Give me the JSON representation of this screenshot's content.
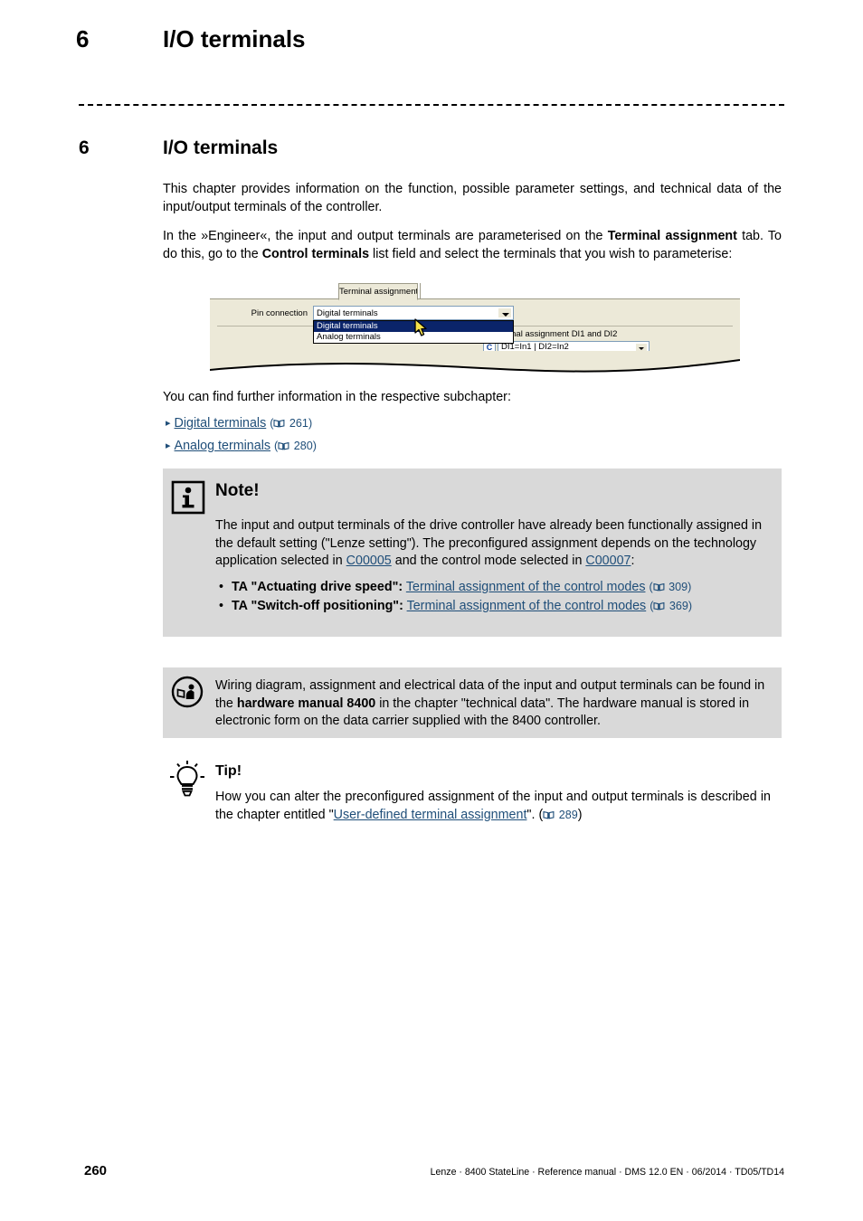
{
  "header": {
    "chapter_number": "6",
    "chapter_title": "I/O terminals"
  },
  "heading": {
    "number": "6",
    "title": "I/O terminals"
  },
  "intro": {
    "paragraph_1": "This chapter provides information on the function, possible parameter settings, and technical data of the input/output terminals of the controller.",
    "p2_part1": "In the »Engineer«, the input and output terminals are parameterised on the ",
    "p2_bold1": "Terminal assignment",
    "p2_part2": " tab. To do this, go to the ",
    "p2_bold2": "Control terminals",
    "p2_part3": " list field and select the terminals that you wish to parameterise:",
    "subchapter_lead": "You can find further information in the respective subchapter:"
  },
  "figure": {
    "tab_label": "Terminal assignment",
    "pin_connection_label": "Pin connection",
    "pin_connection_value": "Digital terminals",
    "dropdown_options": [
      {
        "label": "Digital terminals",
        "selected": true
      },
      {
        "label": "Analog terminals",
        "selected": false
      }
    ],
    "functional_assignment_label": "Functional assignment DI1 and DI2",
    "code_button_label": "C",
    "functional_assignment_value": "DI1=In1 | DI2=In2"
  },
  "subchapter_links": [
    {
      "text": "Digital terminals",
      "page": "261",
      "book_icon": "book-icon"
    },
    {
      "text": "Analog terminals",
      "page": "280",
      "book_icon": "book-icon"
    }
  ],
  "note_box": {
    "icon": "info-icon",
    "title": "Note!",
    "body": "The input and output terminals of the drive controller have already been functionally assigned in the default setting (\"Lenze setting\"). The preconfigured assignment depends on the technology application selected in",
    "link_c00005": "C00005",
    "body_mid": "and the control mode selected in",
    "link_c00007": "C00007",
    "body_end": ":",
    "bullets": [
      {
        "bold": "TA \"Actuating drive speed\":",
        "link": "Terminal assignment of the control modes",
        "page": "309"
      },
      {
        "bold": "TA \"Switch-off positioning\":",
        "link": "Terminal assignment of the control modes",
        "page": "369"
      }
    ]
  },
  "hardware_box": {
    "icon": "read-manual-icon",
    "text_part1": "Wiring diagram, assignment and electrical data of the input and output terminals can be found in the ",
    "bold": "hardware manual 8400",
    "text_part2": " in the chapter \"technical data\". The hardware manual is stored in electronic form on the data carrier supplied with the 8400 controller."
  },
  "tip_block": {
    "icon": "lightbulb-icon",
    "title": "Tip!",
    "text_part1": "How you can alter the preconfigured assignment of the input and output terminals is described in the chapter entitled \"",
    "link": "User-defined terminal assignment",
    "text_part2": "\". (",
    "page": "289",
    "text_part3": ")"
  },
  "footer": {
    "page_number": "260",
    "imprint": "Lenze · 8400 StateLine · Reference manual · DMS 12.0 EN · 06/2014 · TD05/TD14"
  },
  "colors": {
    "link": "#1f4e79",
    "box_background": "#d9d9d9",
    "dialog_background": "#ece9d8",
    "selection_blue": "#0a246a"
  }
}
